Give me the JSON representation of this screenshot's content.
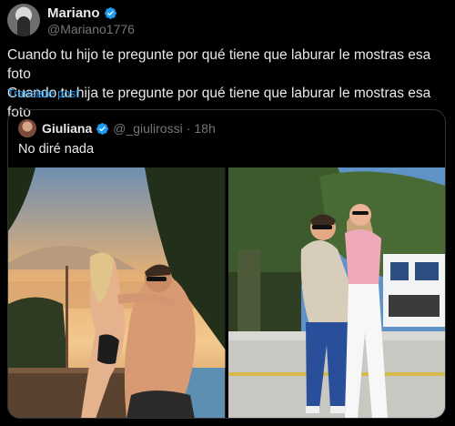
{
  "tweet": {
    "author_name": "Mariano",
    "author_handle": "@Mariano1776",
    "text_line1": "Cuando tu hijo te pregunte por qué tiene que laburar le mostras esa foto",
    "text_line2": "Cuando tu hija te pregunte por qué tiene que laburar le mostras esa foto",
    "translate_label": "Translate post"
  },
  "quoted_post": {
    "author_name": "Giuliana",
    "author_handle": "@_giulirossi",
    "separator": "·",
    "time": "18h",
    "text": "No diré nada"
  },
  "icons": {
    "verified": "verified-badge-icon"
  },
  "colors": {
    "background": "#000000",
    "text_primary": "#e7e9ea",
    "text_secondary": "#71767b",
    "link": "#1d9bf0",
    "verified": "#1d9bf0",
    "border": "#2f3336"
  }
}
